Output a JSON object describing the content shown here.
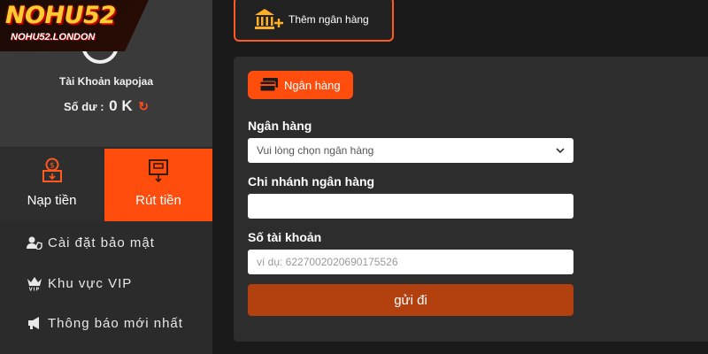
{
  "brand": {
    "logo_text": "NOHU52",
    "logo_subtext": "NOHU52.LONDON"
  },
  "account": {
    "name": "Tài Khoản kapojaa",
    "balance_label": "Số dư :",
    "balance_value": "0 K"
  },
  "tabs": [
    {
      "label": "Nạp tiền",
      "icon": "deposit-icon"
    },
    {
      "label": "Rút tiền",
      "icon": "withdraw-icon",
      "active": true
    }
  ],
  "menu": [
    {
      "label": "Cài đặt bảo mật",
      "icon": "user-shield-icon"
    },
    {
      "label": "Khu vực VIP",
      "icon": "vip-crown-icon"
    },
    {
      "label": "Thông báo mới nhất",
      "icon": "megaphone-icon"
    }
  ],
  "add_bank": {
    "label": "Thêm ngân hàng",
    "icon": "bank-add-icon"
  },
  "form": {
    "chip_label": "Ngân hàng",
    "bank_label": "Ngân hàng",
    "bank_select_value": "Vui lòng chọn ngân hàng",
    "branch_label": "Chi nhánh ngân hàng",
    "branch_value": "",
    "account_label": "Số tài khoản",
    "account_placeholder": "ví dụ: 6227002020690175526",
    "submit_label": "gửi đi"
  },
  "colors": {
    "accent": "#ff4d0d",
    "submit": "#b3400f",
    "panel": "#2d2d2d",
    "sidebar": "#2b2b2b"
  }
}
